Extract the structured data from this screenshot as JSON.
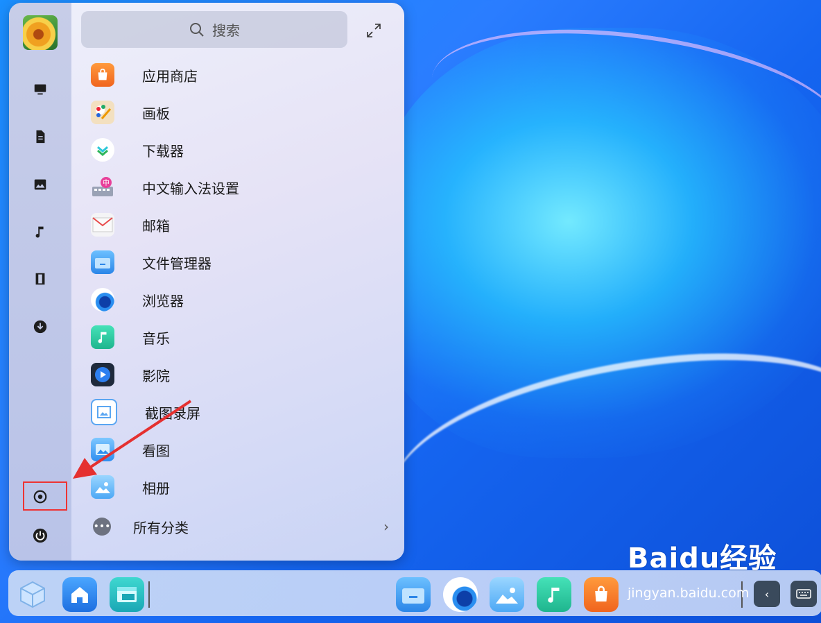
{
  "search": {
    "placeholder": "搜索"
  },
  "apps": [
    {
      "label": "应用商店",
      "icon": "store-icon"
    },
    {
      "label": "画板",
      "icon": "palette-icon"
    },
    {
      "label": "下载器",
      "icon": "downloader-icon"
    },
    {
      "label": "中文输入法设置",
      "icon": "keyboard-icon"
    },
    {
      "label": "邮箱",
      "icon": "mail-icon"
    },
    {
      "label": "文件管理器",
      "icon": "folder-icon"
    },
    {
      "label": "浏览器",
      "icon": "browser-icon"
    },
    {
      "label": "音乐",
      "icon": "music-icon"
    },
    {
      "label": "影院",
      "icon": "video-icon"
    },
    {
      "label": "截图录屏",
      "icon": "screenshot-icon"
    },
    {
      "label": "看图",
      "icon": "image-viewer-icon"
    },
    {
      "label": "相册",
      "icon": "album-icon"
    }
  ],
  "all_categories": {
    "label": "所有分类"
  },
  "watermark": {
    "logo": "Baidu经验",
    "url": "jingyan.baidu.com"
  },
  "colors": {
    "highlight": "#e33333",
    "store": "#f47a2b",
    "music": "#22c7a0",
    "folder": "#3d9cf0"
  }
}
